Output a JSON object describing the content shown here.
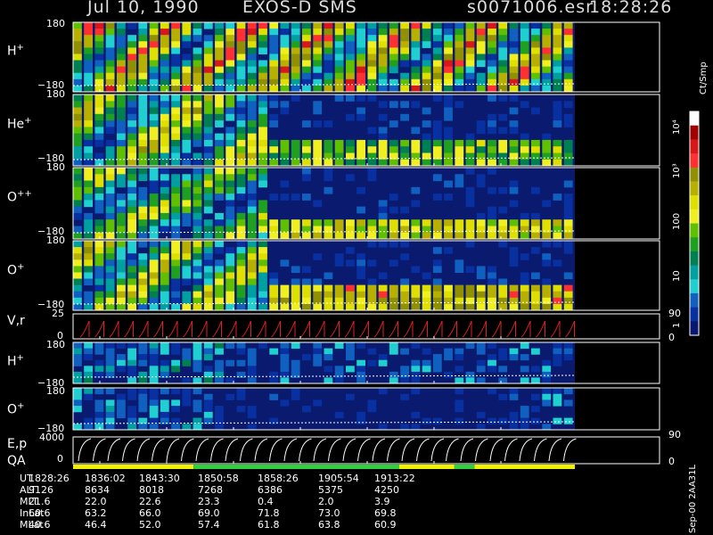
{
  "header": {
    "date": "Jul 10, 1990",
    "instrument": "EXOS-D SMS",
    "file": "s0071006.esr",
    "time": "18:28:26"
  },
  "panels": [
    {
      "label": "H",
      "sup": "+",
      "top": "180",
      "bot": "−180"
    },
    {
      "label": "He",
      "sup": "+",
      "top": "180",
      "bot": "−180"
    },
    {
      "label": "O",
      "sup": "++",
      "top": "180",
      "bot": "−180"
    },
    {
      "label": "O",
      "sup": "+",
      "top": "180",
      "bot": "−180"
    }
  ],
  "vr_panel": {
    "label": "V,r",
    "top": "25",
    "bot": "0",
    "right_top": "90",
    "right_bot": "0"
  },
  "lower_panels": [
    {
      "label": "H",
      "sup": "+",
      "top": "180",
      "bot": "−180"
    },
    {
      "label": "O",
      "sup": "+",
      "top": "180",
      "bot": "−180"
    }
  ],
  "ep_panel": {
    "label1": "E,p",
    "label2": "QA",
    "top": "4000",
    "bot": "0",
    "right_top": "90",
    "right_bot": "0"
  },
  "colorbar": {
    "unit": "Ct/Smp",
    "labels": [
      "10⁴",
      "10³",
      "100",
      "10",
      "1"
    ],
    "colors": [
      "#ffffff",
      "#a00000",
      "#d81818",
      "#ff3030",
      "#909000",
      "#b8b000",
      "#e0e000",
      "#f0f020",
      "#60c000",
      "#20a020",
      "#008050",
      "#00a0a0",
      "#20d0d0",
      "#1060c0",
      "#0830a0",
      "#081870"
    ]
  },
  "footer_id": "Sep-00  2AA31L",
  "table": {
    "rows": [
      {
        "label": "UT",
        "values": [
          "1828:26",
          "1836:02",
          "1843:30",
          "1850:58",
          "1858:26",
          "1905:54",
          "1913:22"
        ]
      },
      {
        "label": "ALT",
        "values": [
          "9126",
          "8634",
          "8018",
          "7268",
          "6386",
          "5375",
          "4250"
        ]
      },
      {
        "label": "MLT",
        "values": [
          "21.6",
          "22.0",
          "22.6",
          "23.3",
          "0.4",
          "2.0",
          "3.9"
        ]
      },
      {
        "label": "InLat",
        "values": [
          "60.6",
          "63.2",
          "66.0",
          "69.0",
          "71.8",
          "73.0",
          "69.8"
        ]
      },
      {
        "label": "MLat",
        "values": [
          "40.6",
          "46.4",
          "52.0",
          "57.4",
          "61.8",
          "63.8",
          "60.9"
        ]
      }
    ]
  },
  "qa_bar": [
    {
      "from": 0.0,
      "to": 0.24,
      "color": "#f0f000"
    },
    {
      "from": 0.24,
      "to": 0.65,
      "color": "#30d040"
    },
    {
      "from": 0.65,
      "to": 0.76,
      "color": "#f0f000"
    },
    {
      "from": 0.76,
      "to": 0.8,
      "color": "#30d040"
    },
    {
      "from": 0.8,
      "to": 1.0,
      "color": "#f0f000"
    }
  ],
  "chart_data": {
    "type": "heatmap",
    "description_free": true,
    "x": [
      "1828:26",
      "1836:02",
      "1843:30",
      "1850:58",
      "1858:26",
      "1905:54",
      "1913:22"
    ],
    "panels": [
      "H+",
      "He+",
      "O++",
      "O+",
      "V,r",
      "H+",
      "O+",
      "E,p"
    ],
    "pitch_angle_range": [
      -180,
      180
    ],
    "vr_range": [
      0,
      25
    ],
    "energy_range": [
      0,
      4000
    ],
    "colorbar_range": [
      "1",
      "10⁴"
    ]
  }
}
